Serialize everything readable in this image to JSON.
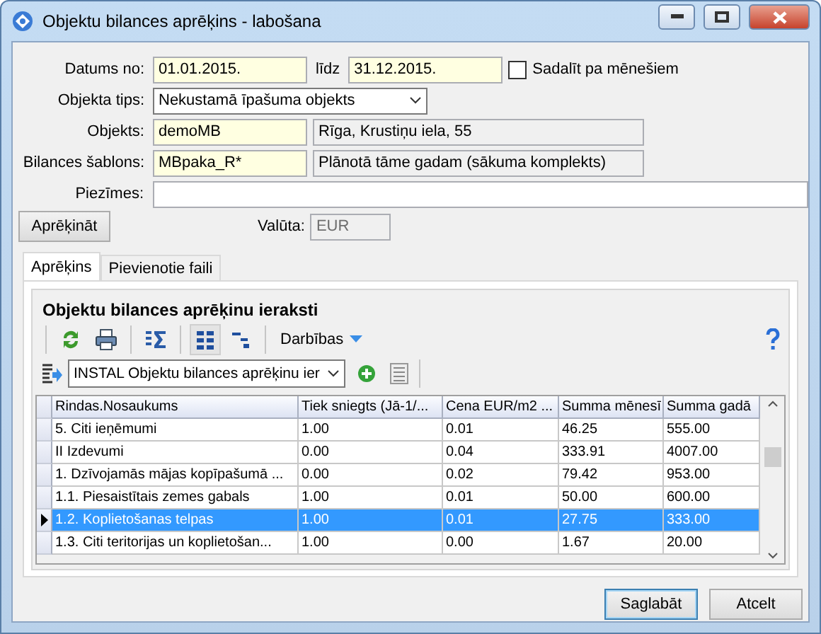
{
  "window": {
    "title": "Objektu bilances aprēķins - labošana"
  },
  "form": {
    "date_from_label": "Datums no:",
    "date_from": "01.01.2015.",
    "date_to_label": "līdz",
    "date_to": "31.12.2015.",
    "split": {
      "label": "Sadalīt pa mēnešiem",
      "checked": false
    },
    "type_label": "Objekta tips:",
    "type_value": "Nekustamā īpašuma objekts",
    "object_label": "Objekts:",
    "object_code": "demoMB",
    "object_name": "Rīga, Krustiņu iela, 55",
    "template_label": "Bilances šablons:",
    "template_code": "MBpaka_R*",
    "template_name": "Plānotā tāme gadam (sākuma komplekts)",
    "notes_label": "Piezīmes:",
    "calculate_button": "Aprēķināt",
    "currency_label": "Valūta:",
    "currency": "EUR"
  },
  "tabs": [
    {
      "label": "Aprēķins",
      "selected": true
    },
    {
      "label": "Pievienotie faili",
      "selected": false
    }
  ],
  "group": {
    "title": "Objektu bilances aprēķinu ieraksti",
    "toolbar": [
      {
        "kind": "refresh",
        "pressed": false
      },
      {
        "kind": "print",
        "pressed": false
      },
      {
        "kind": "sum",
        "pressed": false
      },
      {
        "kind": "columns",
        "pressed": true
      },
      {
        "kind": "tree",
        "pressed": false
      }
    ],
    "actions_menu": "Darbības",
    "view_select": "INSTAL Objektu bilances aprēķinu ier"
  },
  "table": {
    "columns": [
      "Rindas.Nosaukums",
      "Tiek sniegts (Jā-1/...",
      "Cena EUR/m2 ...",
      "Summa mēnesī",
      "Summa gadā"
    ],
    "rows": [
      {
        "cells": [
          "5.  Citi ieņēmumi",
          "1.00",
          "0.01",
          "46.25",
          "555.00"
        ],
        "selected": false
      },
      {
        "cells": [
          "II    Izdevumi",
          "0.00",
          "0.04",
          "333.91",
          "4007.00"
        ],
        "selected": false
      },
      {
        "cells": [
          "1.  Dzīvojamās mājas kopīpašumā ...",
          "0.00",
          "0.02",
          "79.42",
          "953.00"
        ],
        "selected": false
      },
      {
        "cells": [
          "1.1.  Piesaistītais zemes gabals",
          "1.00",
          "0.01",
          "50.00",
          "600.00"
        ],
        "selected": false
      },
      {
        "cells": [
          "1.2.  Koplietošanas telpas",
          "1.00",
          "0.01",
          "27.75",
          "333.00"
        ],
        "selected": true
      },
      {
        "cells": [
          "1.3.  Citi teritorijas un koplietošan...",
          "1.00",
          "0.00",
          "1.67",
          "20.00"
        ],
        "selected": false
      }
    ]
  },
  "buttons": {
    "save": "Saglabāt",
    "cancel": "Atcelt"
  }
}
